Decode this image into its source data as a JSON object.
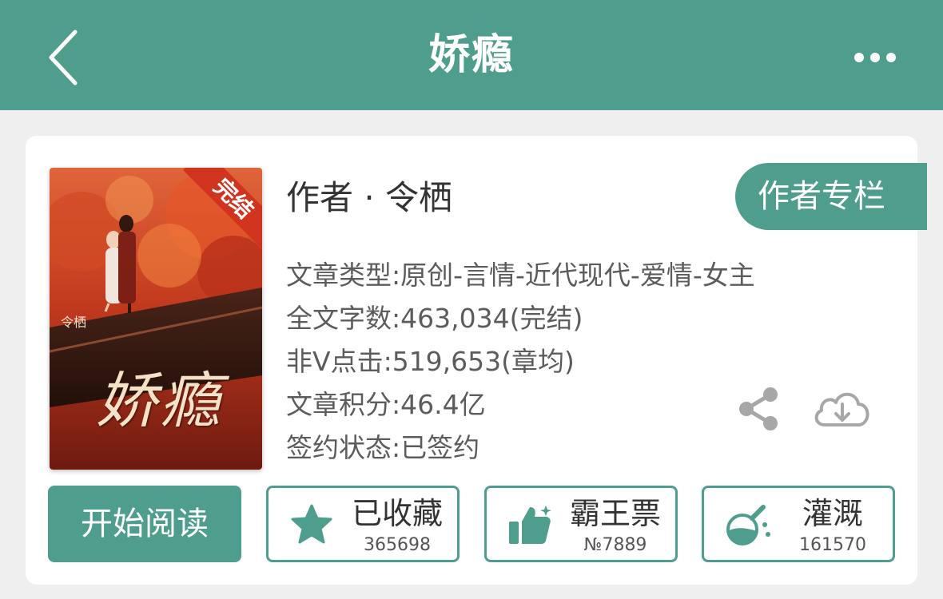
{
  "header": {
    "title": "娇瘾",
    "back_icon": "chevron-left-icon",
    "more_icon": "more-horizontal-icon"
  },
  "book": {
    "cover": {
      "badge": "完结",
      "title_art": "娇瘾",
      "author": "令栖"
    },
    "author_line": "作者 · 令栖",
    "author_column_button": "作者专栏",
    "info": [
      "文章类型:原创-言情-近代现代-爱情-女主",
      "全文字数:463,034(完结)",
      "非Ⅴ点击:519,653(章均)",
      "文章积分:46.4亿",
      "签约状态:已签约"
    ]
  },
  "actions": {
    "read_label": "开始阅读",
    "collect": {
      "label": "已收藏",
      "count": "365698",
      "icon": "star-icon"
    },
    "vote": {
      "label": "霸王票",
      "count": "№7889",
      "icon": "thumbs-up-icon"
    },
    "water": {
      "label": "灌溉",
      "count": "161570",
      "icon": "watering-flask-icon"
    },
    "share_icon": "share-icon",
    "download_icon": "cloud-download-icon"
  },
  "colors": {
    "brand": "#4e9d8d",
    "background": "#efefef",
    "card": "#ffffff",
    "text_dark": "#333333",
    "text_muted": "#5c5c5c"
  }
}
